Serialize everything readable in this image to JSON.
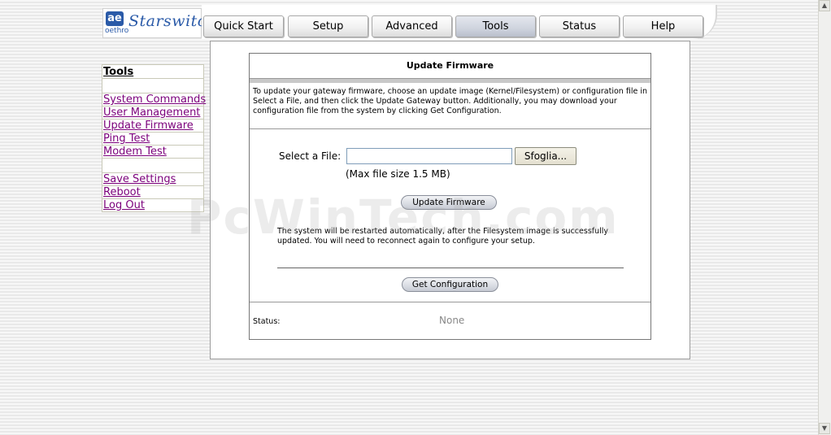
{
  "brand": {
    "mark": "ae",
    "sub": "oethro",
    "name": "Starswitch"
  },
  "nav": {
    "tabs": [
      {
        "label": "Quick Start"
      },
      {
        "label": "Setup"
      },
      {
        "label": "Advanced"
      },
      {
        "label": "Tools",
        "active": true
      },
      {
        "label": "Status"
      },
      {
        "label": "Help"
      }
    ]
  },
  "sidebar": {
    "title": "Tools",
    "group1": [
      "System Commands",
      "User Management",
      "Update Firmware",
      "Ping Test",
      "Modem Test"
    ],
    "group2": [
      "Save Settings",
      "Reboot",
      "Log Out"
    ]
  },
  "panel": {
    "title": "Update Firmware",
    "description": "To update your gateway firmware, choose an update image (Kernel/Filesystem) or configuration file in Select a File, and then click the Update Gateway button. Additionally, you may download your configuration file from the system by clicking Get Configuration.",
    "file_label": "Select a File:",
    "file_value": "",
    "browse_label": "Sfoglia...",
    "max_size": "(Max file size 1.5 MB)",
    "update_label": "Update Firmware",
    "restart_note": "The system will be restarted automatically, after the Filesystem image is successfully updated. You will need to reconnect again to configure your setup.",
    "getconf_label": "Get Configuration",
    "status_label": "Status:",
    "status_value": "None"
  },
  "watermark": "PcWinTech.com",
  "colors": {
    "link": "#7b007b",
    "brand": "#2a5aa8"
  }
}
